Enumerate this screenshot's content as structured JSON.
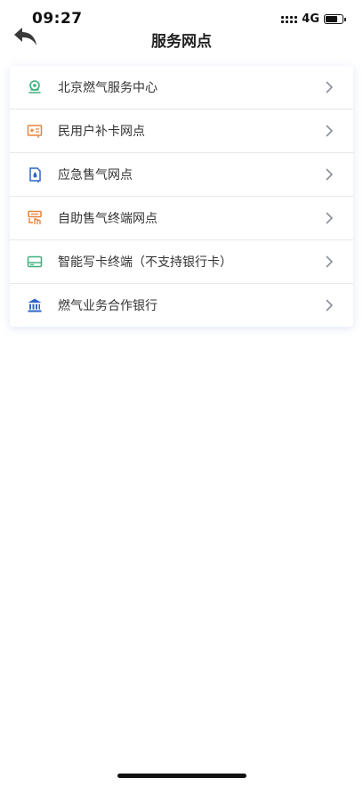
{
  "status_bar": {
    "time": "09:27",
    "network": "4G"
  },
  "nav": {
    "title": "服务网点",
    "back_icon": "back-arrow-icon"
  },
  "menu": {
    "items": [
      {
        "label": "北京燃气服务中心",
        "icon": "service-center-icon",
        "color": "#3bb17a"
      },
      {
        "label": "民用户补卡网点",
        "icon": "card-reissue-icon",
        "color": "#e8833a"
      },
      {
        "label": "应急售气网点",
        "icon": "emergency-gas-icon",
        "color": "#2f64c8"
      },
      {
        "label": "自助售气终端网点",
        "icon": "self-service-terminal-icon",
        "color": "#e8833a"
      },
      {
        "label": "智能写卡终端（不支持银行卡）",
        "icon": "smart-card-icon",
        "color": "#3bb17a"
      },
      {
        "label": "燃气业务合作银行",
        "icon": "bank-icon",
        "color": "#2f64c8"
      }
    ],
    "chevron_icon": "chevron-right-icon"
  }
}
